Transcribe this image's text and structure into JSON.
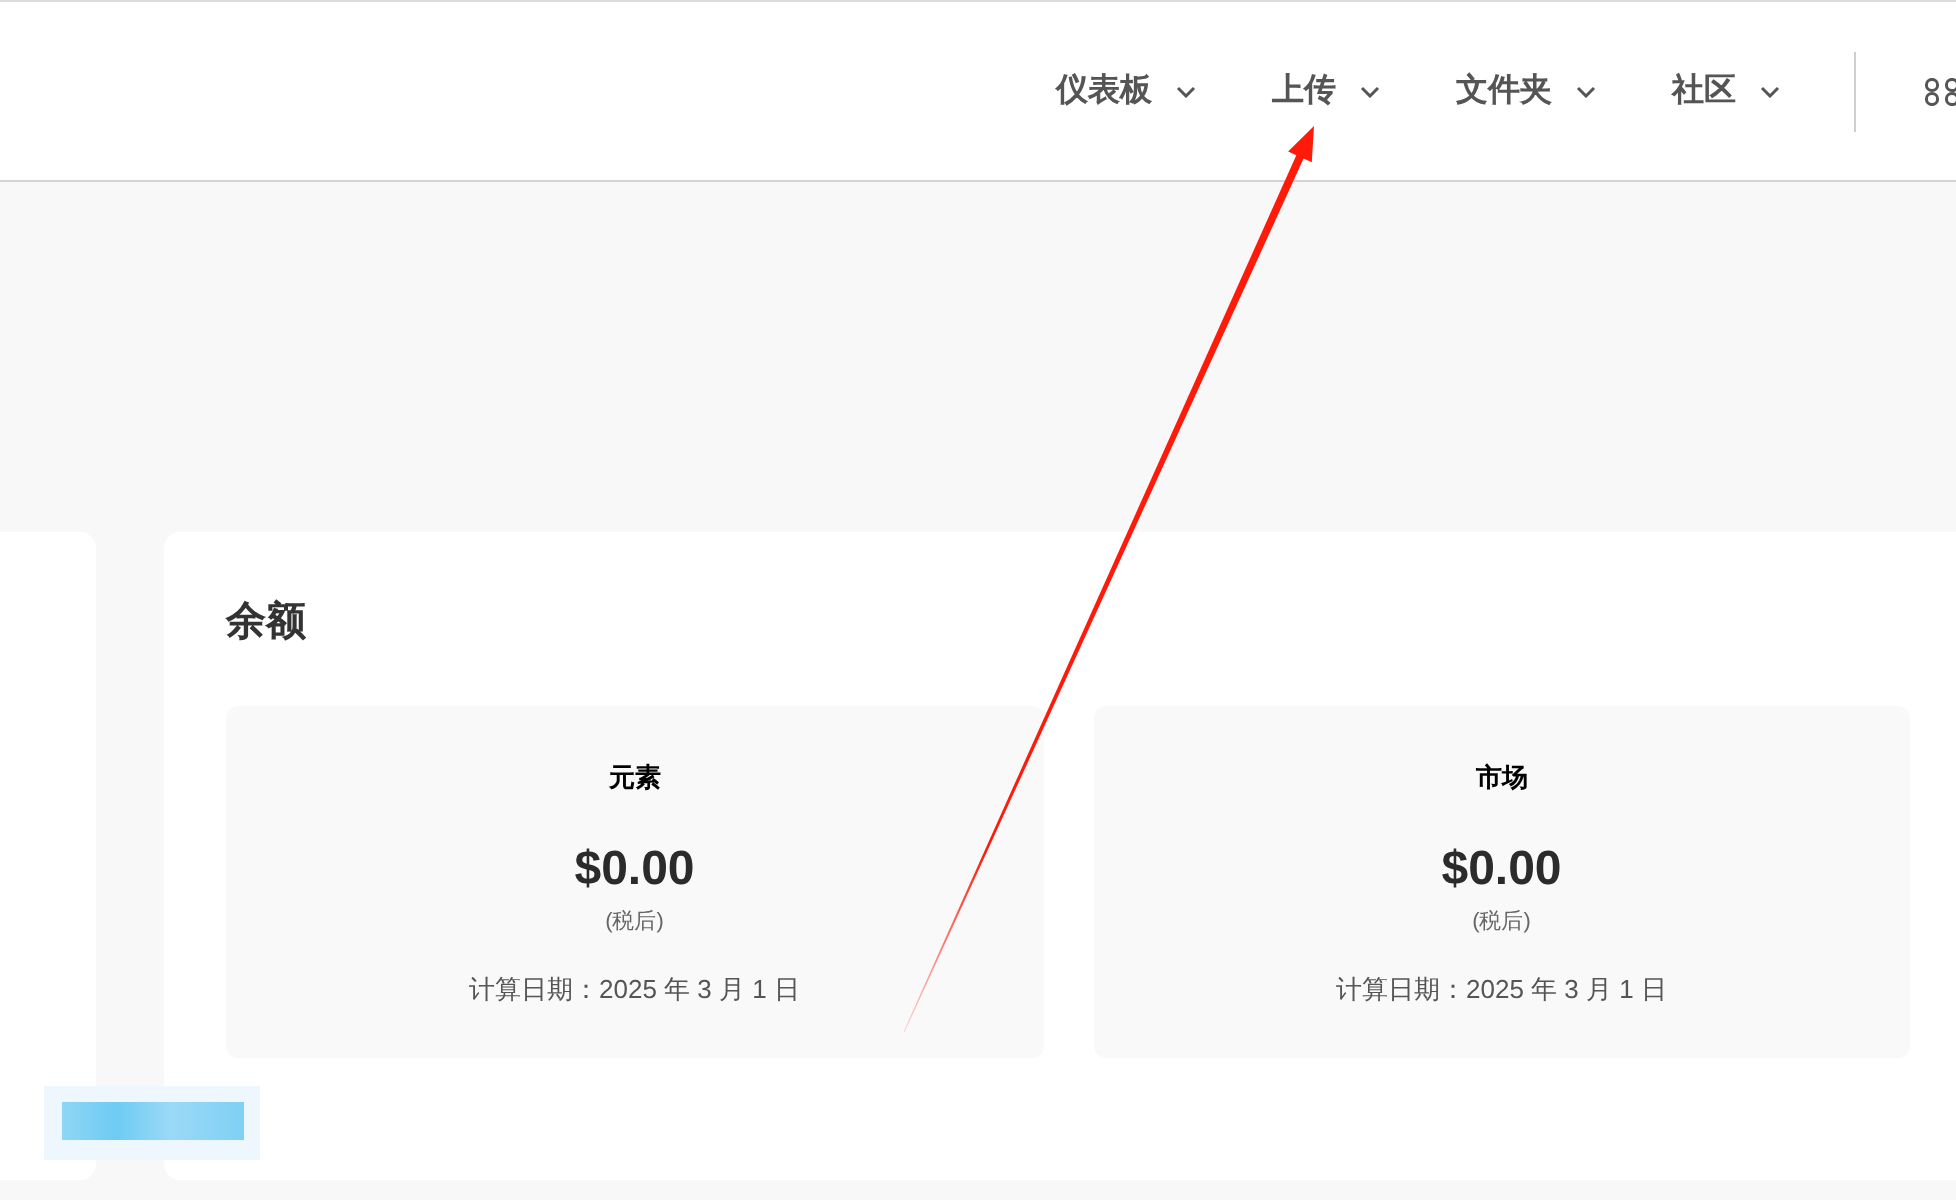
{
  "nav": {
    "items": [
      {
        "label": "仪表板"
      },
      {
        "label": "上传"
      },
      {
        "label": "文件夹"
      },
      {
        "label": "社区"
      }
    ]
  },
  "balance": {
    "title": "余额",
    "accounts": [
      {
        "name": "元素",
        "amount": "$0.00",
        "tax_note": "(税后)",
        "date": "计算日期：2025 年 3 月 1 日"
      },
      {
        "name": "市场",
        "amount": "$0.00",
        "tax_note": "(税后)",
        "date": "计算日期：2025 年 3 月 1 日"
      }
    ]
  }
}
